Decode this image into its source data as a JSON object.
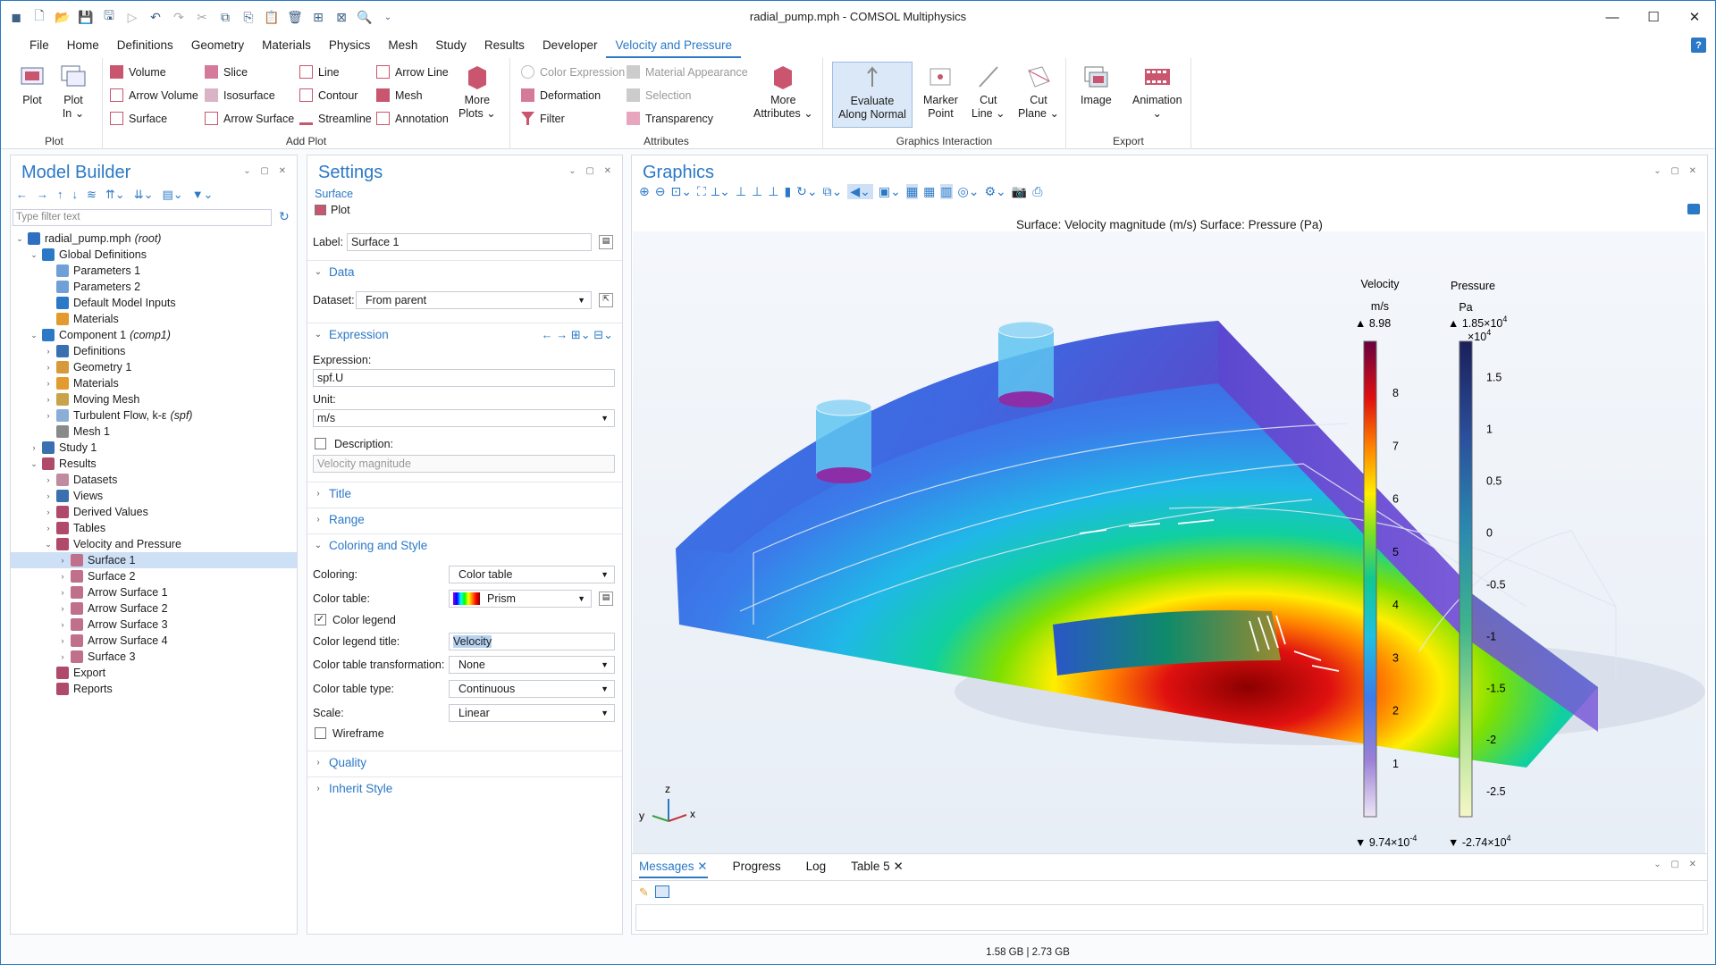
{
  "window": {
    "title": "radial_pump.mph - COMSOL Multiphysics",
    "minimize": "—",
    "maximize": "☐",
    "close": "✕"
  },
  "menu": [
    "File",
    "Home",
    "Definitions",
    "Geometry",
    "Materials",
    "Physics",
    "Mesh",
    "Study",
    "Results",
    "Developer",
    "Velocity and Pressure"
  ],
  "menu_active": "Velocity and Pressure",
  "help": "?",
  "ribbon": {
    "plot_group": {
      "label": "Plot",
      "plot": "Plot",
      "plot_in": "Plot\nIn ⌄"
    },
    "add_plot": {
      "label": "Add Plot",
      "items": [
        "Volume",
        "Slice",
        "Line",
        "Arrow Line",
        "Arrow Volume",
        "Isosurface",
        "Contour",
        "Mesh",
        "Surface",
        "Arrow Surface",
        "Streamline",
        "Annotation"
      ],
      "more_plots": "More\nPlots ⌄"
    },
    "attributes": {
      "label": "Attributes",
      "color_expression": "Color Expression",
      "material_appearance": "Material Appearance",
      "deformation": "Deformation",
      "selection": "Selection",
      "filter": "Filter",
      "transparency": "Transparency",
      "more_attributes": "More\nAttributes ⌄"
    },
    "graphics_interaction": {
      "label": "Graphics Interaction",
      "evaluate": "Evaluate\nAlong Normal",
      "marker": "Marker\nPoint",
      "cut_line": "Cut\nLine ⌄",
      "cut_plane": "Cut\nPlane ⌄"
    },
    "export": {
      "label": "Export",
      "image": "Image",
      "animation": "Animation\n⌄"
    }
  },
  "model_builder": {
    "title": "Model Builder",
    "filter_placeholder": "Type filter text",
    "tree": [
      {
        "label": "radial_pump.mph",
        "suffix": "(root)",
        "level": 0,
        "tw": "v",
        "color": "#2e6fbf"
      },
      {
        "label": "Global Definitions",
        "level": 1,
        "tw": "v",
        "color": "#2b79c6"
      },
      {
        "label": "Parameters 1",
        "level": 2,
        "tw": "",
        "color": "#6fa0d8"
      },
      {
        "label": "Parameters 2",
        "level": 2,
        "tw": "",
        "color": "#6fa0d8"
      },
      {
        "label": "Default Model Inputs",
        "level": 2,
        "tw": "",
        "color": "#2b79c6"
      },
      {
        "label": "Materials",
        "level": 2,
        "tw": "",
        "color": "#e39a2e"
      },
      {
        "label": "Component 1",
        "suffix": "(comp1)",
        "level": 1,
        "tw": "v",
        "color": "#2b79c6"
      },
      {
        "label": "Definitions",
        "level": 2,
        "tw": ">",
        "color": "#3a6fb0"
      },
      {
        "label": "Geometry 1",
        "level": 2,
        "tw": ">",
        "color": "#d69a3a"
      },
      {
        "label": "Materials",
        "level": 2,
        "tw": ">",
        "color": "#e39a2e"
      },
      {
        "label": "Moving Mesh",
        "level": 2,
        "tw": ">",
        "color": "#c9a34a"
      },
      {
        "label": "Turbulent Flow, k-ε",
        "suffix": "(spf)",
        "level": 2,
        "tw": ">",
        "color": "#8aaed6"
      },
      {
        "label": "Mesh 1",
        "level": 2,
        "tw": "",
        "color": "#8a8a8a"
      },
      {
        "label": "Study 1",
        "level": 1,
        "tw": ">",
        "color": "#3a6fb0"
      },
      {
        "label": "Results",
        "level": 1,
        "tw": "v",
        "color": "#b04a6a"
      },
      {
        "label": "Datasets",
        "level": 2,
        "tw": ">",
        "color": "#c08aa0"
      },
      {
        "label": "Views",
        "level": 2,
        "tw": ">",
        "color": "#3a6fb0"
      },
      {
        "label": "Derived Values",
        "level": 2,
        "tw": ">",
        "color": "#b04a6a"
      },
      {
        "label": "Tables",
        "level": 2,
        "tw": ">",
        "color": "#b04a6a"
      },
      {
        "label": "Velocity and Pressure",
        "level": 2,
        "tw": "v",
        "color": "#b04a6a"
      },
      {
        "label": "Surface 1",
        "level": 3,
        "tw": ">",
        "color": "#c0708a",
        "selected": true
      },
      {
        "label": "Surface 2",
        "level": 3,
        "tw": ">",
        "color": "#c0708a"
      },
      {
        "label": "Arrow Surface 1",
        "level": 3,
        "tw": ">",
        "color": "#c0708a"
      },
      {
        "label": "Arrow Surface 2",
        "level": 3,
        "tw": ">",
        "color": "#c0708a"
      },
      {
        "label": "Arrow Surface 3",
        "level": 3,
        "tw": ">",
        "color": "#c0708a"
      },
      {
        "label": "Arrow Surface 4",
        "level": 3,
        "tw": ">",
        "color": "#c0708a"
      },
      {
        "label": "Surface 3",
        "level": 3,
        "tw": ">",
        "color": "#c0708a"
      },
      {
        "label": "Export",
        "level": 2,
        "tw": "",
        "color": "#b04a6a"
      },
      {
        "label": "Reports",
        "level": 2,
        "tw": "",
        "color": "#b04a6a"
      }
    ]
  },
  "settings": {
    "title": "Settings",
    "subtitle": "Surface",
    "plot_button": "Plot",
    "label_caption": "Label:",
    "label_value": "Surface 1",
    "data_section": "Data",
    "dataset_caption": "Dataset:",
    "dataset_value": "From parent",
    "expression_section": "Expression",
    "expression_caption": "Expression:",
    "expression_value": "spf.U",
    "unit_caption": "Unit:",
    "unit_value": "m/s",
    "description_caption": "Description:",
    "description_value": "Velocity magnitude",
    "title_section": "Title",
    "range_section": "Range",
    "coloring_section": "Coloring and Style",
    "coloring_caption": "Coloring:",
    "coloring_value": "Color table",
    "color_table_caption": "Color table:",
    "color_table_value": "Prism",
    "color_legend_caption": "Color legend",
    "legend_title_caption": "Color legend title:",
    "legend_title_value": "Velocity",
    "transformation_caption": "Color table transformation:",
    "transformation_value": "None",
    "type_caption": "Color table type:",
    "type_value": "Continuous",
    "scale_caption": "Scale:",
    "scale_value": "Linear",
    "wireframe_caption": "Wireframe",
    "quality_section": "Quality",
    "inherit_section": "Inherit Style"
  },
  "graphics": {
    "title": "Graphics",
    "plot_title": "Surface: Velocity magnitude (m/s)  Surface: Pressure (Pa)",
    "axis_labels": {
      "z": "z",
      "y": "y",
      "x": "x"
    },
    "legend_velocity": {
      "title": "Velocity",
      "unit": "m/s",
      "max": "▲ 8.98",
      "min": "▼ 9.74×10",
      "min_exp": "-4",
      "ticks": [
        "8",
        "7",
        "6",
        "5",
        "4",
        "3",
        "2",
        "1"
      ],
      "tick_values": [
        8,
        7,
        6,
        5,
        4,
        3,
        2,
        1
      ],
      "range": [
        0.000974,
        8.98
      ]
    },
    "legend_pressure": {
      "title": "Pressure",
      "unit": "Pa",
      "max": "▲ 1.85×10",
      "max_exp": "4",
      "mult": "×10",
      "mult_exp": "4",
      "min": "▼ -2.74×10",
      "min_exp": "4",
      "ticks": [
        "1.5",
        "1",
        "0.5",
        "0",
        "-0.5",
        "-1",
        "-1.5",
        "-2",
        "-2.5"
      ],
      "tick_values": [
        1.5,
        1,
        0.5,
        0,
        -0.5,
        -1,
        -1.5,
        -2,
        -2.5
      ],
      "range": [
        -2.74,
        1.85
      ]
    }
  },
  "messages": {
    "tabs": [
      "Messages ✕",
      "Progress",
      "Log",
      "Table 5 ✕"
    ]
  },
  "status": {
    "memory": "1.58 GB | 2.73 GB"
  }
}
